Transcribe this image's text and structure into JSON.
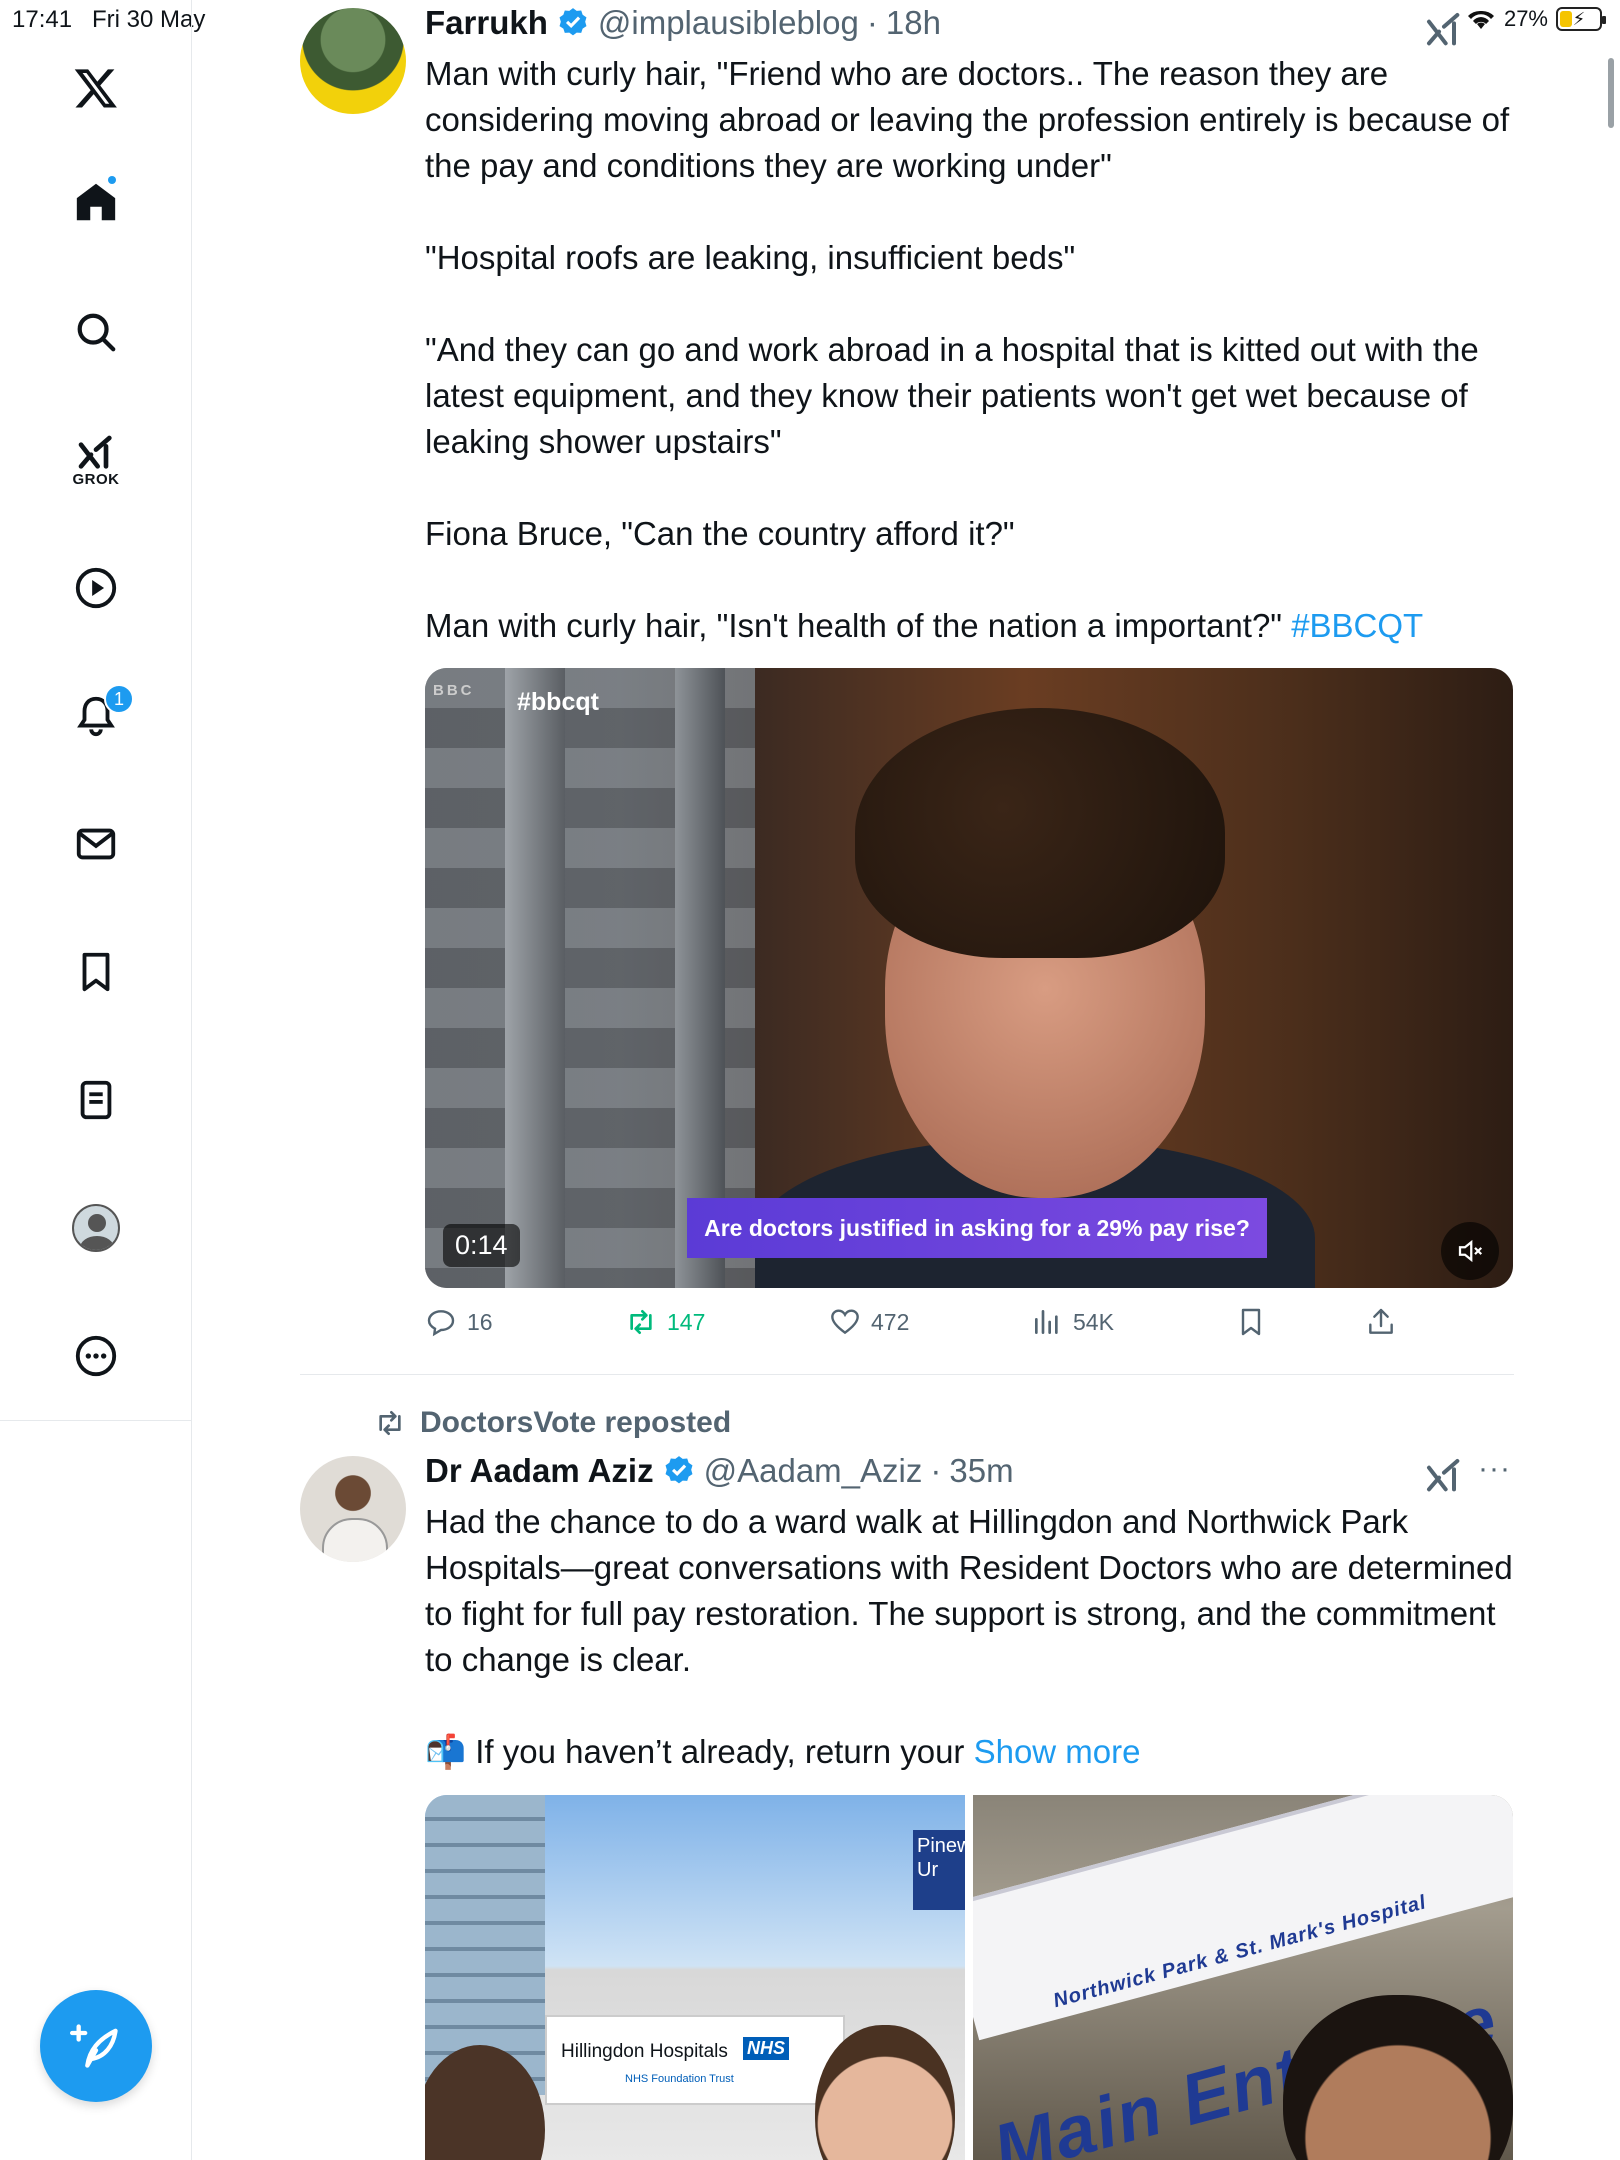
{
  "status_bar": {
    "time": "17:41",
    "date": "Fri 30 May",
    "battery": "27%"
  },
  "sidebar": {
    "grok_label": "GROK",
    "notification_count": "1"
  },
  "tweet1": {
    "name": "Farrukh",
    "handle": "@implausibleblog",
    "sep": "·",
    "time": "18h",
    "paragraphs": [
      "Man with curly hair, \"Friend who are doctors.. The reason they are considering moving abroad or leaving the profession entirely is because of the pay and conditions they are working under\"",
      "\"Hospital roofs are leaking, insufficient beds\"",
      "\"And they can go and work abroad in a hospital that is kitted out with the latest equipment, and they know their patients won't get wet because of leaking shower upstairs\"",
      "Fiona Bruce, \"Can the country afford it?\""
    ],
    "last_paragraph": "Man with curly hair, \"Isn't health of the nation a important?\" ",
    "hashtag": "#BBCQT",
    "video": {
      "bbc_tag": "BBC",
      "overlay_hashtag": "#bbcqt",
      "caption": "Are doctors justified in asking for a 29% pay rise?",
      "duration": "0:14"
    },
    "actions": {
      "replies": "16",
      "reposts": "147",
      "likes": "472",
      "views": "54K"
    }
  },
  "tweet2": {
    "repost_label": "DoctorsVote reposted",
    "name": "Dr Aadam Aziz",
    "handle": "@Aadam_Aziz",
    "sep": "·",
    "time": "35m",
    "more": "···",
    "paragraph1": "Had the chance to do a ward walk at Hillingdon and Northwick Park Hospitals—great conversations with Resident Doctors who are determined to fight for full pay restoration. The support is strong, and the commitment to change is clear.",
    "paragraph2": "📬 If you haven’t already, return your ",
    "show_more": "Show more",
    "image_left": {
      "sign": "Hillingdon Hospitals",
      "nhs": "NHS",
      "sub": "NHS Foundation Trust",
      "pine_sign": "Pinew Ur"
    },
    "image_right": {
      "banner_small": "Northwick Park & St. Mark's Hospital",
      "banner_big": "Main Entrance"
    }
  },
  "colors": {
    "accent": "#1d9bf0",
    "repost_green": "#00ba7c",
    "muted": "#536471"
  }
}
